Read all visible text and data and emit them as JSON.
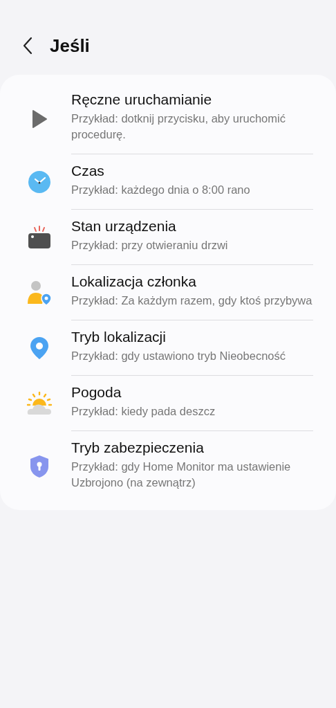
{
  "header": {
    "title": "Jeśli"
  },
  "items": [
    {
      "kind": "manual",
      "title": "Ręczne uruchamianie",
      "subtitle": "Przykład: dotknij przycisku, aby uruchomić procedurę."
    },
    {
      "kind": "time",
      "title": "Czas",
      "subtitle": "Przykład: każdego dnia o 8:00 rano"
    },
    {
      "kind": "device",
      "title": "Stan urządzenia",
      "subtitle": "Przykład: przy otwieraniu drzwi"
    },
    {
      "kind": "member",
      "title": "Lokalizacja członka",
      "subtitle": "Przykład: Za każdym razem, gdy ktoś przybywa"
    },
    {
      "kind": "location",
      "title": "Tryb lokalizacji",
      "subtitle": "Przykład: gdy ustawiono tryb Nieobecność"
    },
    {
      "kind": "weather",
      "title": "Pogoda",
      "subtitle": "Przykład: kiedy pada deszcz"
    },
    {
      "kind": "security",
      "title": "Tryb zabezpieczenia",
      "subtitle": "Przykład: gdy Home Monitor ma ustawienie Uzbrojono (na zewnątrz)"
    }
  ]
}
